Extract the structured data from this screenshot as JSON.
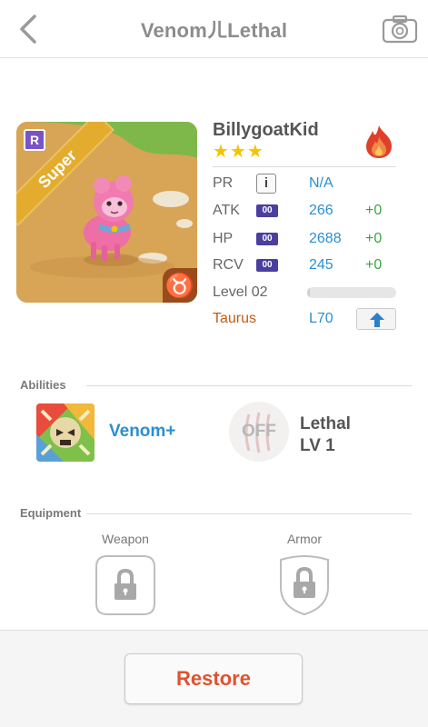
{
  "header": {
    "title": "VenomㄦLethal",
    "back_icon": "back-chevron-icon",
    "camera_icon": "camera-icon"
  },
  "pet": {
    "rarity_badge": "R",
    "ribbon": "Super",
    "zodiac_symbol": "♉",
    "name": "BillygoatKid",
    "stars": "★★★",
    "element_icon": "fire-icon"
  },
  "stats": {
    "pr_label": "PR",
    "pr_info": "i",
    "pr_value": "N/A",
    "atk_label": "ATK",
    "atk_tag": "00",
    "atk_value": "266",
    "atk_bonus": "+0",
    "hp_label": "HP",
    "hp_tag": "00",
    "hp_value": "2688",
    "hp_bonus": "+0",
    "rcv_label": "RCV",
    "rcv_tag": "00",
    "rcv_value": "245",
    "rcv_bonus": "+0",
    "level_label": "Level 02",
    "level_progress": 0.03,
    "sign_label": "Taurus",
    "max_level": "L70"
  },
  "abilities": {
    "section_label": "Abilities",
    "primary_name": "Venom+",
    "secondary_status": "OFF",
    "secondary_name": "Lethal",
    "secondary_level": "LV 1"
  },
  "equipment": {
    "section_label": "Equipment",
    "weapon_label": "Weapon",
    "armor_label": "Armor"
  },
  "footer": {
    "restore_label": "Restore"
  },
  "colors": {
    "accent_blue": "#2b8fd1",
    "bonus_green": "#3aa640",
    "restore_orange": "#e0522f",
    "taurus_brown": "#c45b12"
  }
}
